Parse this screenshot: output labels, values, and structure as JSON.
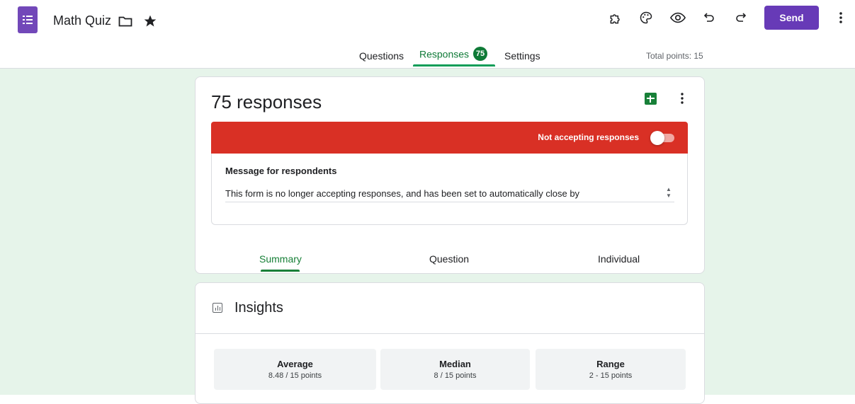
{
  "app": {
    "title": "Math Quiz",
    "send_label": "Send"
  },
  "tabs": {
    "questions": "Questions",
    "responses": "Responses",
    "responses_count": "75",
    "settings": "Settings",
    "total_points": "Total points: 15"
  },
  "summary_card": {
    "title": "75 responses",
    "banner_text": "Not accepting responses",
    "message_label": "Message for respondents",
    "message_text": "This form is no longer accepting responses, and has been set to automatically close by",
    "subtabs": [
      "Summary",
      "Question",
      "Individual"
    ]
  },
  "insights": {
    "title": "Insights",
    "stats": [
      {
        "label": "Average",
        "value": "8.48 / 15 points"
      },
      {
        "label": "Median",
        "value": "8 / 15 points"
      },
      {
        "label": "Range",
        "value": "2 - 15 points"
      }
    ]
  },
  "colors": {
    "accent_purple": "#673ab7",
    "accent_green": "#188038",
    "banner_red": "#d93025",
    "background_green": "#e6f4ea"
  },
  "icons": [
    "forms-logo-icon",
    "folder-icon",
    "star-icon",
    "addon-puzzle-icon",
    "palette-icon",
    "preview-eye-icon",
    "undo-icon",
    "redo-icon",
    "more-vert-icon",
    "sheets-icon",
    "insights-chart-icon"
  ]
}
